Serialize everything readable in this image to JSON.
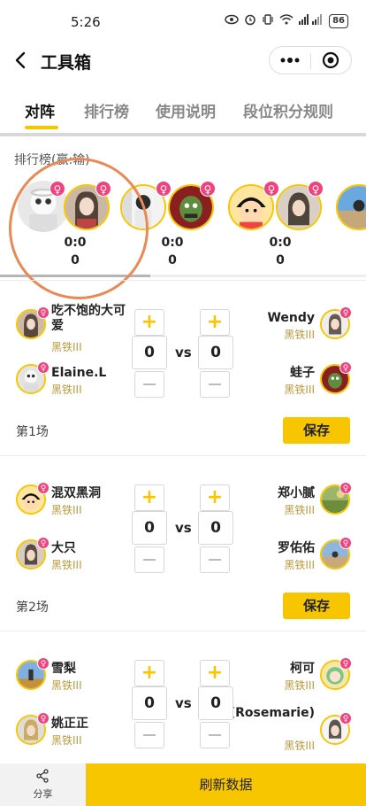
{
  "status_bar": {
    "time": "5:26",
    "battery": "86",
    "signal": "5G 4G"
  },
  "header": {
    "title": "工具箱"
  },
  "tabs": [
    {
      "label": "对阵"
    },
    {
      "label": "排行榜"
    },
    {
      "label": "使用说明"
    },
    {
      "label": "段位积分规则"
    }
  ],
  "ranking": {
    "label": "排行榜(赢:输)",
    "pairs": [
      {
        "ratio": "0:0",
        "score": "0"
      },
      {
        "ratio": "0:0",
        "score": "0"
      },
      {
        "ratio": "0:0",
        "score": "0"
      }
    ]
  },
  "female_symbol": "♀",
  "vs_text": "vs",
  "matches": [
    {
      "game_label": "第1场",
      "save_label": "保存",
      "score_left": "0",
      "score_right": "0",
      "left_top": {
        "name": "吃不饱的大可爱",
        "rank": "黑铁III"
      },
      "left_bottom": {
        "name": "Elaine.L",
        "rank": "黑铁III"
      },
      "right_top": {
        "name": "Wendy",
        "rank": "黑铁III"
      },
      "right_bottom": {
        "name": "蛙子",
        "rank": "黑铁III"
      }
    },
    {
      "game_label": "第2场",
      "save_label": "保存",
      "score_left": "0",
      "score_right": "0",
      "left_top": {
        "name": "混双黑洞",
        "rank": "黑铁III"
      },
      "left_bottom": {
        "name": "大只",
        "rank": "黑铁III"
      },
      "right_top": {
        "name": "郑小腻",
        "rank": "黑铁III"
      },
      "right_bottom": {
        "name": "罗佑佑",
        "rank": "黑铁III"
      }
    },
    {
      "score_left": "0",
      "score_right": "0",
      "left_top": {
        "name": "雪梨",
        "rank": "黑铁III"
      },
      "left_bottom": {
        "name": "姚正正",
        "rank": "黑铁III"
      },
      "right_top": {
        "name": "柯可",
        "rank": "黑铁III"
      },
      "right_bottom": {
        "name": "婷婷(Rosemarie)",
        "rank": "黑铁III"
      }
    }
  ],
  "bottom_bar": {
    "share_label": "分享",
    "refresh_label": "刷新数据"
  },
  "colors": {
    "accent": "#f7c600",
    "female_badge": "#f0427d",
    "rank_text": "#b89a3e"
  }
}
